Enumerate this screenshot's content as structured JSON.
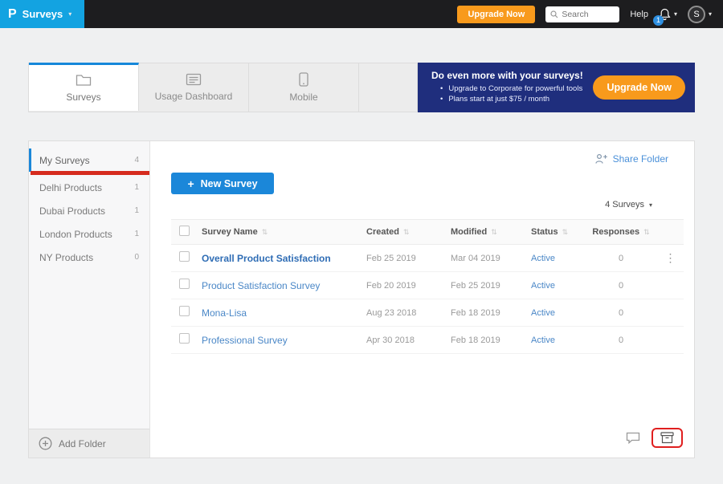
{
  "topbar": {
    "logo_letter": "P",
    "product_menu": "Surveys",
    "upgrade_button": "Upgrade Now",
    "search_placeholder": "Search",
    "help_label": "Help",
    "notification_count": "1",
    "avatar_initial": "S"
  },
  "icons": {
    "caret_down": "▾",
    "sort": "⇅",
    "plus": "+",
    "dots": "⋮"
  },
  "tabs": [
    {
      "label": "Surveys"
    },
    {
      "label": "Usage Dashboard"
    },
    {
      "label": "Mobile"
    }
  ],
  "promo": {
    "title": "Do even more with your surveys!",
    "bullets": [
      "Upgrade to Corporate for powerful tools",
      "Plans start at just $75 / month"
    ],
    "button": "Upgrade Now"
  },
  "sidebar": {
    "folders": [
      {
        "name": "My Surveys",
        "count": "4"
      },
      {
        "name": "Delhi Products",
        "count": "1"
      },
      {
        "name": "Dubai Products",
        "count": "1"
      },
      {
        "name": "London Products",
        "count": "1"
      },
      {
        "name": "NY Products",
        "count": "0"
      }
    ],
    "add_folder_label": "Add Folder"
  },
  "content": {
    "share_folder_label": "Share Folder",
    "new_survey_label": "New Survey",
    "survey_count_label": "4 Surveys",
    "table": {
      "headers": [
        "Survey Name",
        "Created",
        "Modified",
        "Status",
        "Responses"
      ],
      "rows": [
        {
          "name": "Overall Product Satisfaction",
          "created": "Feb 25 2019",
          "modified": "Mar 04 2019",
          "status": "Active",
          "responses": "0"
        },
        {
          "name": "Product Satisfaction Survey",
          "created": "Feb 20 2019",
          "modified": "Feb 25 2019",
          "status": "Active",
          "responses": "0"
        },
        {
          "name": "Mona-Lisa",
          "created": "Aug 23 2018",
          "modified": "Feb 18 2019",
          "status": "Active",
          "responses": "0"
        },
        {
          "name": "Professional Survey",
          "created": "Apr 30 2018",
          "modified": "Feb 18 2019",
          "status": "Active",
          "responses": "0"
        }
      ]
    }
  },
  "colors": {
    "brand_cyan": "#13a3e1",
    "accent_blue": "#1b87d9",
    "accent_orange": "#f89a1c",
    "promo_navy": "#1f2e7d",
    "link_blue": "#4a87c7",
    "annotation_red": "#d62b1e"
  }
}
